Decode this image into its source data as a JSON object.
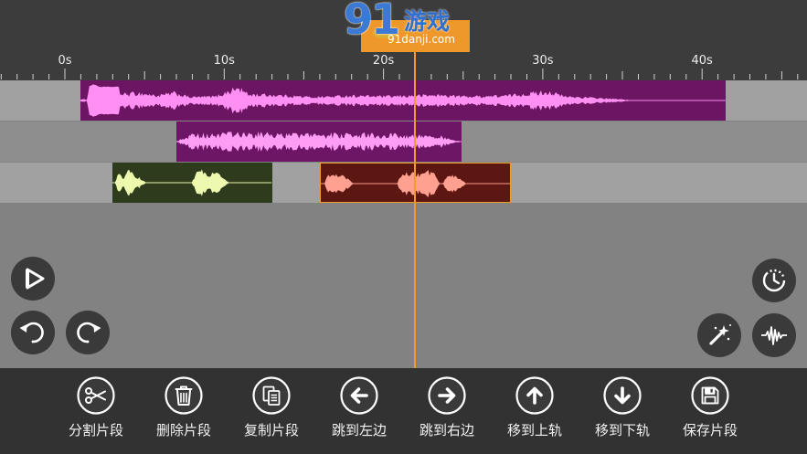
{
  "watermark": {
    "logo_number": "91",
    "logo_text": "游戏",
    "domain": "91danji.com"
  },
  "timeline": {
    "ruler_labels": [
      {
        "label": "0s",
        "t": 0
      },
      {
        "label": "10s",
        "t": 10
      },
      {
        "label": "20s",
        "t": 20
      },
      {
        "label": "30s",
        "t": 30
      },
      {
        "label": "40s",
        "t": 40
      }
    ],
    "playhead_s": 22.0,
    "accent_color": "#f29a2e",
    "tracks": [
      {
        "clips": [
          {
            "start_s": 1.0,
            "end_s": 41.5,
            "fill": "#6b1563",
            "wave": "#ff8ff2",
            "selected": false
          }
        ]
      },
      {
        "clips": [
          {
            "start_s": 7.0,
            "end_s": 24.9,
            "fill": "#6d1666",
            "wave": "#ff9cf4",
            "selected": false
          }
        ]
      },
      {
        "clips": [
          {
            "start_s": 3.0,
            "end_s": 13.0,
            "fill": "#2f3b1d",
            "wave": "#eef9b0",
            "selected": false
          },
          {
            "start_s": 16.0,
            "end_s": 28.0,
            "fill": "#5d1712",
            "wave": "#ffa091",
            "selected": true
          }
        ]
      }
    ]
  },
  "controls": {
    "play_icon": "play-icon",
    "undo_icon": "undo-icon",
    "redo_icon": "redo-icon",
    "history_icon": "clock-icon",
    "effects_icon": "magic-wand-icon",
    "waveform_icon": "waveform-icon"
  },
  "toolbar": {
    "items": [
      {
        "label": "分割片段",
        "icon": "scissors-icon"
      },
      {
        "label": "删除片段",
        "icon": "trash-icon"
      },
      {
        "label": "复制片段",
        "icon": "copy-icon"
      },
      {
        "label": "跳到左边",
        "icon": "arrow-left-icon"
      },
      {
        "label": "跳到右边",
        "icon": "arrow-right-icon"
      },
      {
        "label": "移到上轨",
        "icon": "arrow-up-icon"
      },
      {
        "label": "移到下轨",
        "icon": "arrow-down-icon"
      },
      {
        "label": "保存片段",
        "icon": "save-icon"
      }
    ]
  }
}
